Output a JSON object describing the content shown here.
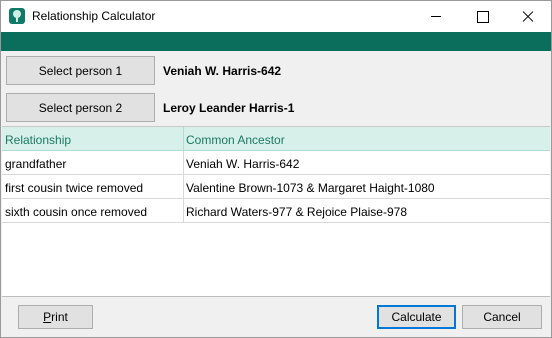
{
  "window": {
    "title": "Relationship Calculator",
    "icon": "tree-icon",
    "accent_color": "#0b6e5d"
  },
  "selectors": {
    "person1_button": "Select person 1",
    "person1_name": "Veniah W. Harris-642",
    "person2_button": "Select person 2",
    "person2_name": "Leroy Leander Harris-1"
  },
  "table": {
    "headers": [
      "Relationship",
      "Common Ancestor"
    ],
    "rows": [
      [
        "grandfather",
        "Veniah W. Harris-642"
      ],
      [
        "first cousin twice removed",
        "Valentine Brown-1073 & Margaret Haight-1080"
      ],
      [
        "sixth cousin once removed",
        "Richard Waters-977 & Rejoice Plaise-978"
      ]
    ]
  },
  "footer": {
    "print_first": "P",
    "print_rest": "rint",
    "calculate": "Calculate",
    "cancel": "Cancel"
  }
}
